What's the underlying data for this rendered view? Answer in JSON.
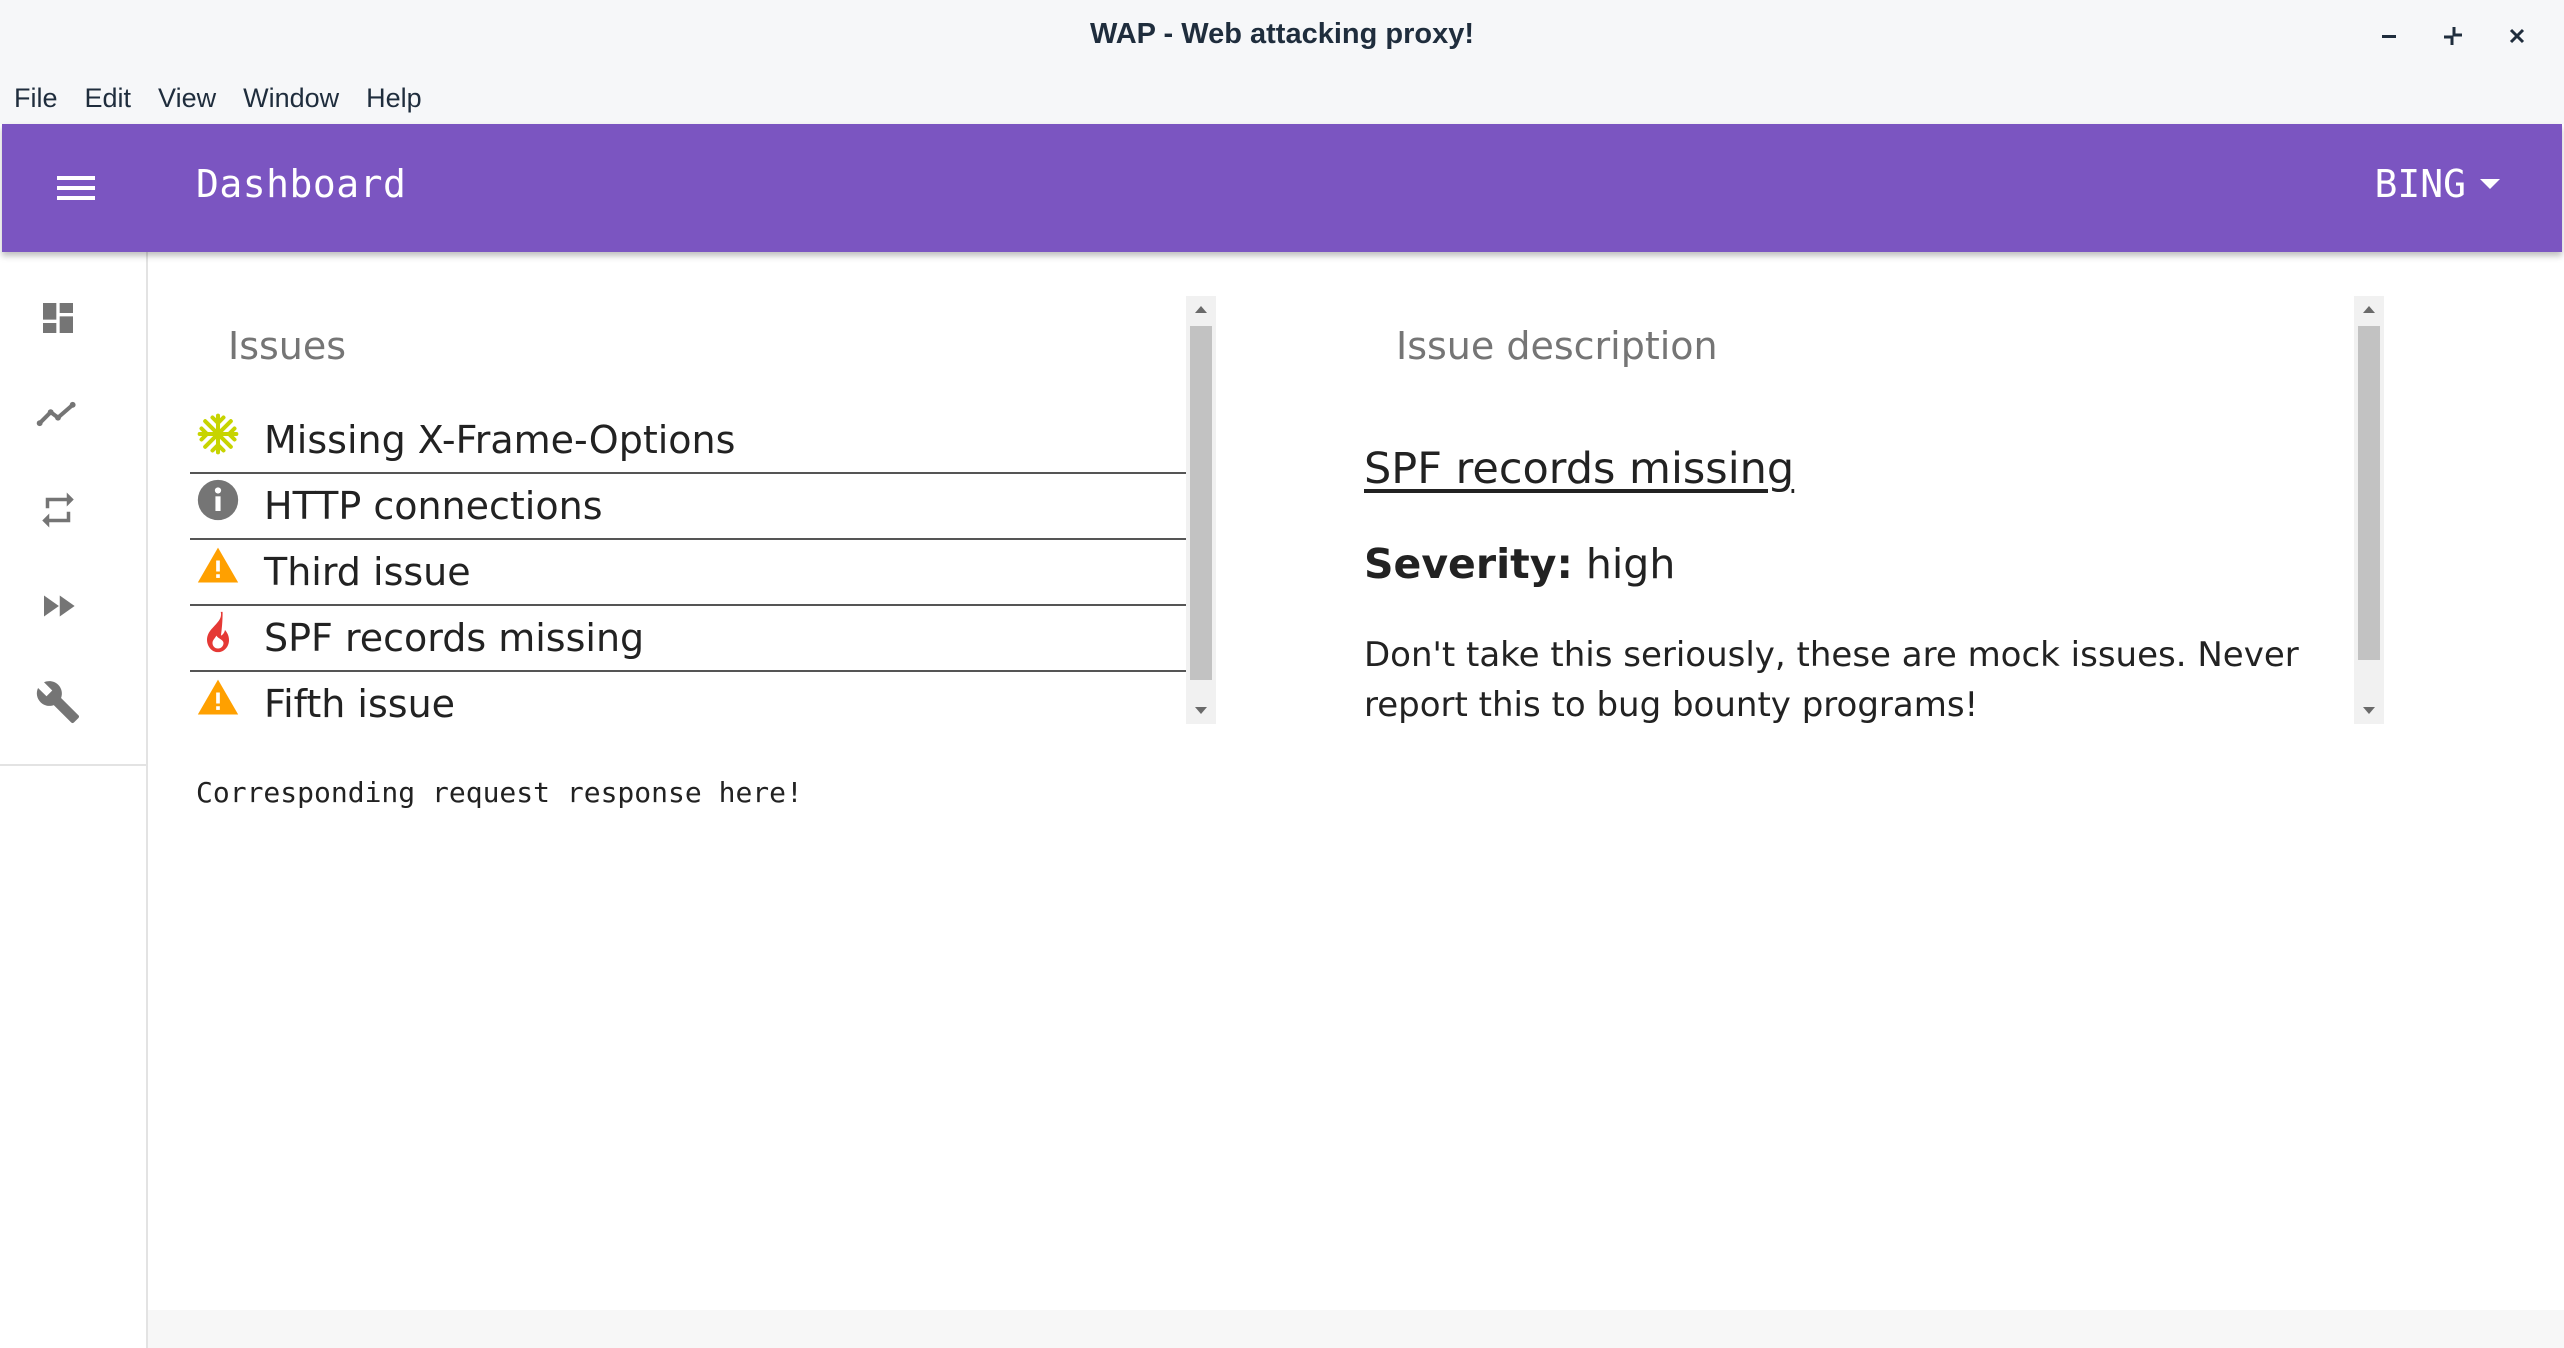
{
  "window": {
    "title": "WAP - Web attacking proxy!",
    "controls": [
      "minimize-icon",
      "restore-icon",
      "close-icon"
    ]
  },
  "menubar": {
    "items": [
      "File",
      "Edit",
      "View",
      "Window",
      "Help"
    ]
  },
  "appbar": {
    "title": "Dashboard",
    "domain_selected": "BING",
    "color": "#7b55c1"
  },
  "sidenav": {
    "items": [
      {
        "icon": "dashboard-icon"
      },
      {
        "icon": "trending-icon"
      },
      {
        "icon": "repeat-icon"
      },
      {
        "icon": "fast-forward-icon"
      },
      {
        "icon": "wrench-icon"
      }
    ]
  },
  "issues": {
    "heading": "Issues",
    "items": [
      {
        "label": "Missing X-Frame-Options",
        "icon": "snowflake-icon",
        "color": "#c7d400"
      },
      {
        "label": "HTTP connections",
        "icon": "info-icon",
        "color": "#757575"
      },
      {
        "label": "Third issue",
        "icon": "warning-icon",
        "color": "#ffa000"
      },
      {
        "label": "SPF records missing",
        "icon": "fire-icon",
        "color": "#e53935"
      },
      {
        "label": "Fifth issue",
        "icon": "warning-icon",
        "color": "#ffa000"
      }
    ]
  },
  "request_response": "Corresponding request response here!",
  "description": {
    "heading": "Issue description",
    "title": "SPF records missing",
    "severity_label": "Severity:",
    "severity_value": "high",
    "body": "Don't take this seriously, these are mock issues. Never report this to bug bounty programs!"
  }
}
